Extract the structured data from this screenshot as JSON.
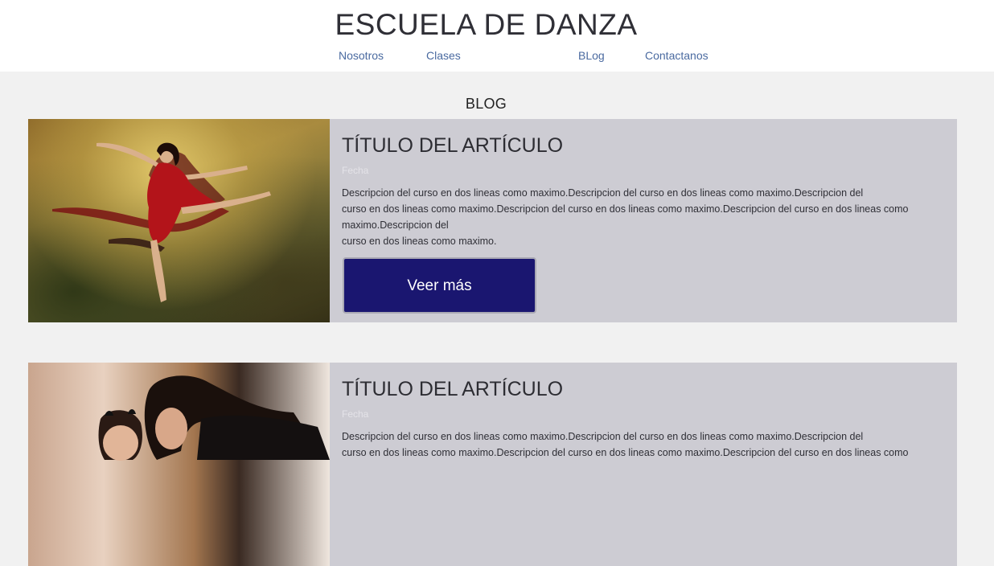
{
  "header": {
    "site_title": "ESCUELA DE DANZA",
    "nav": [
      "Nosotros",
      "Clases",
      "BLog",
      "Contactanos"
    ]
  },
  "blog": {
    "section_title": "BLOG",
    "articles": [
      {
        "title": "TÍTULO DEL ARTÍCULO",
        "date": "Fecha",
        "desc_lines": [
          "Descripcion del curso en dos lineas como maximo.Descripcion del curso en dos lineas como maximo.Descripcion del",
          "curso en dos lineas como maximo.Descripcion del curso en dos lineas como maximo.Descripcion del curso en dos lineas como",
          "maximo.Descripcion del",
          "curso en dos lineas como maximo."
        ],
        "button_label": "Veer más",
        "image_icon": "dancer-photo"
      },
      {
        "title": "TÍTULO DEL ARTÍCULO",
        "date": "Fecha",
        "desc_lines": [
          "Descripcion del curso en dos lineas como maximo.Descripcion del curso en dos lineas como maximo.Descripcion del",
          "curso en dos lineas como maximo.Descripcion del curso en dos lineas como maximo.Descripcion del curso en dos lineas como"
        ],
        "image_icon": "mother-child-photo"
      }
    ]
  },
  "colors": {
    "header_bg": "#ffffff",
    "page_bg": "#f1f1f1",
    "card_bg": "#cdccd3",
    "nav_link": "#4a6aa0",
    "button_bg": "#1a1670"
  }
}
